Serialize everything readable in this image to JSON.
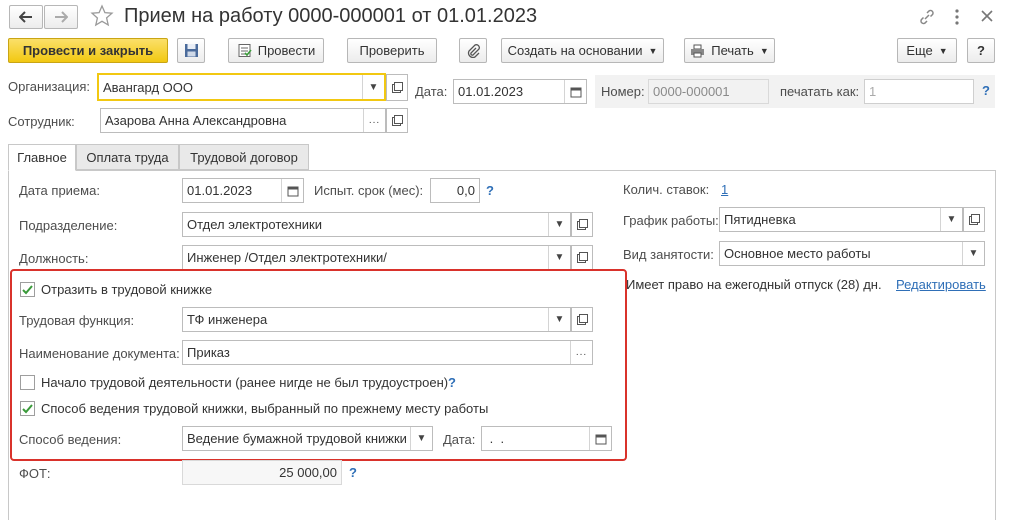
{
  "window": {
    "title": "Прием на работу 0000-000001 от 01.01.2023"
  },
  "toolbar": {
    "post_close": "Провести и закрыть",
    "post": "Провести",
    "check": "Проверить",
    "create_based": "Создать на основании",
    "print": "Печать",
    "more": "Еще",
    "help": "?"
  },
  "header": {
    "org_label": "Организация:",
    "org_value": "Авангард ООО",
    "date_label": "Дата:",
    "date_value": "01.01.2023",
    "number_label": "Номер:",
    "number_value": "0000-000001",
    "print_as_label": "печатать как:",
    "print_as_value": "1",
    "employee_label": "Сотрудник:",
    "employee_value": "Азарова Анна Александровна"
  },
  "tabs": [
    {
      "label": "Главное"
    },
    {
      "label": "Оплата труда"
    },
    {
      "label": "Трудовой договор"
    }
  ],
  "main": {
    "hire_date_label": "Дата приема:",
    "hire_date_value": "01.01.2023",
    "probation_label": "Испыт. срок (мес):",
    "probation_value": "0,0",
    "rate_count_label": "Колич. ставок:",
    "rate_count_value": "1",
    "department_label": "Подразделение:",
    "department_value": "Отдел электротехники",
    "schedule_label": "График работы:",
    "schedule_value": "Пятидневка",
    "position_label": "Должность:",
    "position_value": "Инженер /Отдел электротехники/",
    "employment_label": "Вид занятости:",
    "employment_value": "Основное место работы",
    "vacation_text": "Имеет право на ежегодный отпуск (28) дн.",
    "edit_link": "Редактировать",
    "fot_label": "ФОТ:",
    "fot_value": "25 000,00",
    "help": "?"
  },
  "workbook": {
    "reflect_label": "Отразить в трудовой книжке",
    "labor_function_label": "Трудовая функция:",
    "labor_function_value": "ТФ инженера",
    "doc_name_label": "Наименование документа:",
    "doc_name_value": "Приказ",
    "career_start_label": "Начало трудовой деятельности (ранее нигде не был трудоустроен)",
    "method_prev_label": "Способ ведения трудовой книжки, выбранный по прежнему месту работы",
    "method_label": "Способ ведения:",
    "method_value": "Ведение бумажной трудовой книжки",
    "date_label": "Дата:",
    "date_value": " .  ."
  },
  "colors": {
    "primary_button": "#f7d12e",
    "highlight_border": "#d9322b",
    "link": "#2f6fb7",
    "check": "#3a9a3a"
  }
}
